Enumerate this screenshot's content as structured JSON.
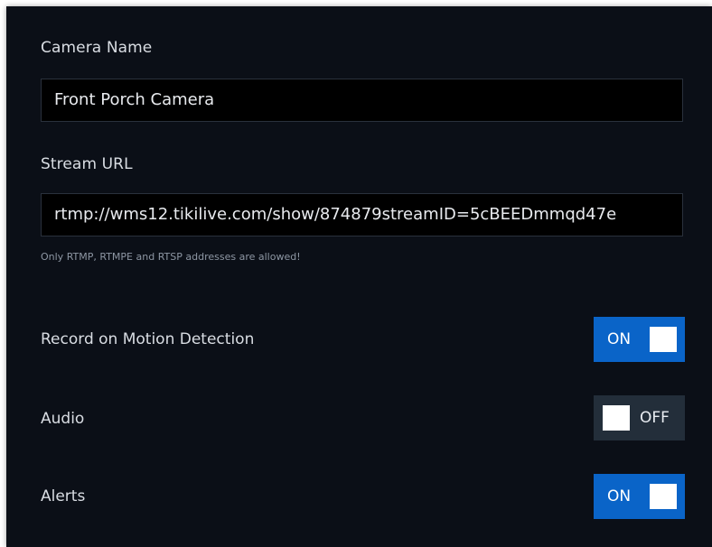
{
  "camera_name": {
    "label": "Camera Name",
    "value": "Front Porch Camera"
  },
  "stream_url": {
    "label": "Stream URL",
    "value": "rtmp://wms12.tikilive.com/show/874879streamID=5cBEEDmmqd47e",
    "hint": "Only RTMP, RTMPE and RTSP addresses are allowed!"
  },
  "settings": {
    "record_motion": {
      "label": "Record on Motion Detection",
      "state": "ON"
    },
    "audio": {
      "label": "Audio",
      "state": "OFF"
    },
    "alerts": {
      "label": "Alerts",
      "state": "ON"
    }
  },
  "colors": {
    "panel_bg": "#0b0f17",
    "toggle_on": "#0a64c8",
    "toggle_off": "#232e3a"
  }
}
